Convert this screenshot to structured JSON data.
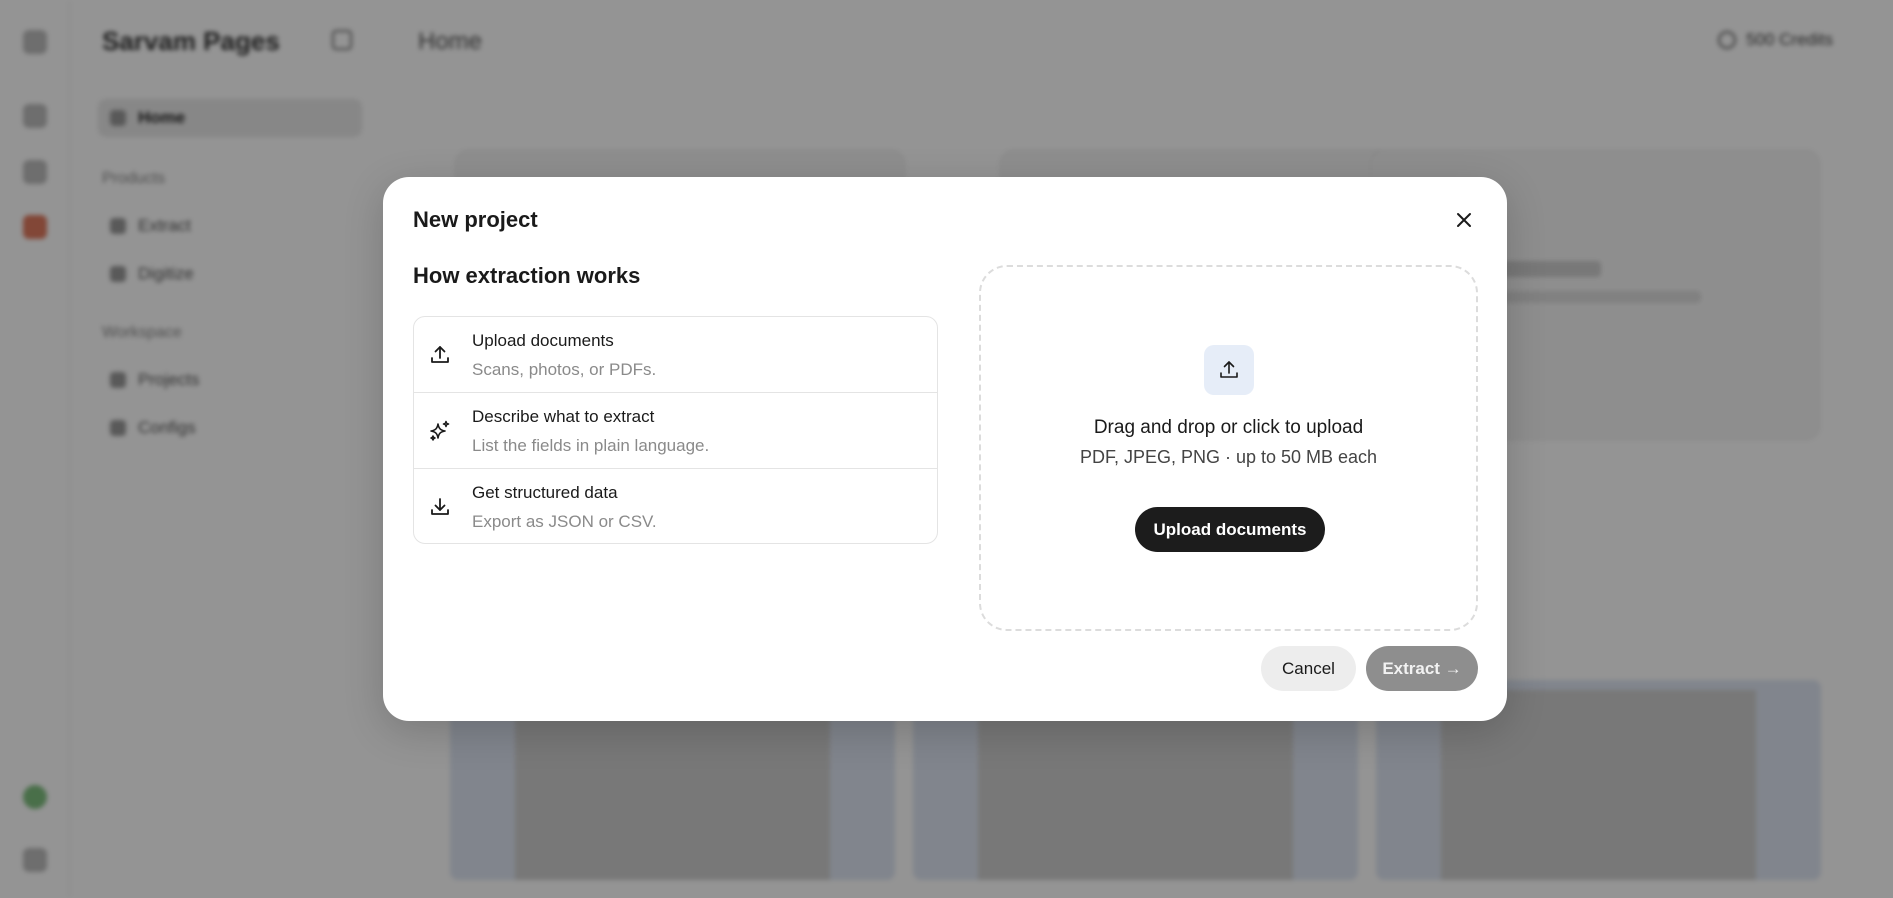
{
  "background": {
    "brand": "Sarvam Pages",
    "page_title": "Home",
    "credits": "500 Credits",
    "sidebar": {
      "home": "Home",
      "products_heading": "Products",
      "extract": "Extract",
      "digitize": "Digitize",
      "workspace_heading": "Workspace",
      "projects": "Projects",
      "configs": "Configs"
    }
  },
  "modal": {
    "title": "New project",
    "close_icon": "close-icon",
    "how_title": "How extraction works",
    "steps": [
      {
        "icon": "upload-icon",
        "title": "Upload documents",
        "desc": "Scans, photos, or PDFs."
      },
      {
        "icon": "sparkle-icon",
        "title": "Describe what to extract",
        "desc": "List the fields in plain language."
      },
      {
        "icon": "download-icon",
        "title": "Get structured data",
        "desc": "Export as JSON or CSV."
      }
    ],
    "dropzone": {
      "icon": "upload-icon",
      "title": "Drag and drop or click to upload",
      "subtitle": "PDF, JPEG, PNG · up to 50 MB each",
      "button": "Upload documents"
    },
    "cancel_label": "Cancel",
    "extract_label": "Extract →"
  },
  "colors": {
    "overlay": "#000000",
    "primary_button": "#1c1c1c",
    "disabled_button": "#8e8e8e",
    "dropzone_icon_bg": "#e6edf8"
  }
}
